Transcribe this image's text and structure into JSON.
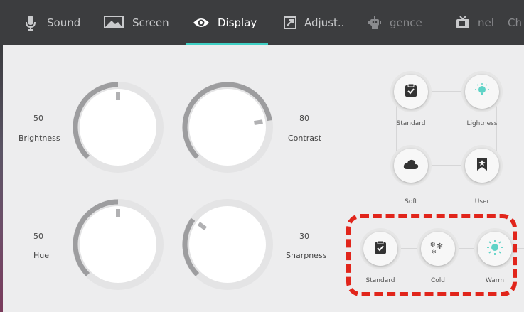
{
  "tabs": [
    {
      "label": "Sound",
      "icon": "microphone-icon"
    },
    {
      "label": "Screen",
      "icon": "screen-icon"
    },
    {
      "label": "Display",
      "icon": "eye-icon",
      "active": true
    },
    {
      "label": "Adjust..",
      "icon": "adjust-icon"
    },
    {
      "label": "gence",
      "icon": "robot-icon"
    },
    {
      "label": "nel",
      "icon": "tv-icon"
    },
    {
      "label": "Ch",
      "icon": ""
    }
  ],
  "knobs": [
    {
      "name": "Brightness",
      "value": "50",
      "level": 0.5
    },
    {
      "name": "Contrast",
      "value": "80",
      "level": 0.8
    },
    {
      "name": "Hue",
      "value": "50",
      "level": 0.5
    },
    {
      "name": "Sharpness",
      "value": "30",
      "level": 0.3
    }
  ],
  "picture_modes": [
    {
      "label": "Standard",
      "icon": "clipboard-check-icon"
    },
    {
      "label": "Lightness",
      "icon": "lightbulb-icon"
    },
    {
      "label": "Soft",
      "icon": "cloud-icon"
    },
    {
      "label": "User",
      "icon": "bookmark-star-icon"
    }
  ],
  "color_temperature": [
    {
      "label": "Standard",
      "icon": "clipboard-check-icon"
    },
    {
      "label": "Cold",
      "icon": "snowflake-icon"
    },
    {
      "label": "Warm",
      "icon": "sun-icon"
    }
  ],
  "colors": {
    "accent": "#3fd0c4",
    "highlight": "#e1251b",
    "topbar": "#3c3d3f",
    "panel": "#ededee"
  }
}
